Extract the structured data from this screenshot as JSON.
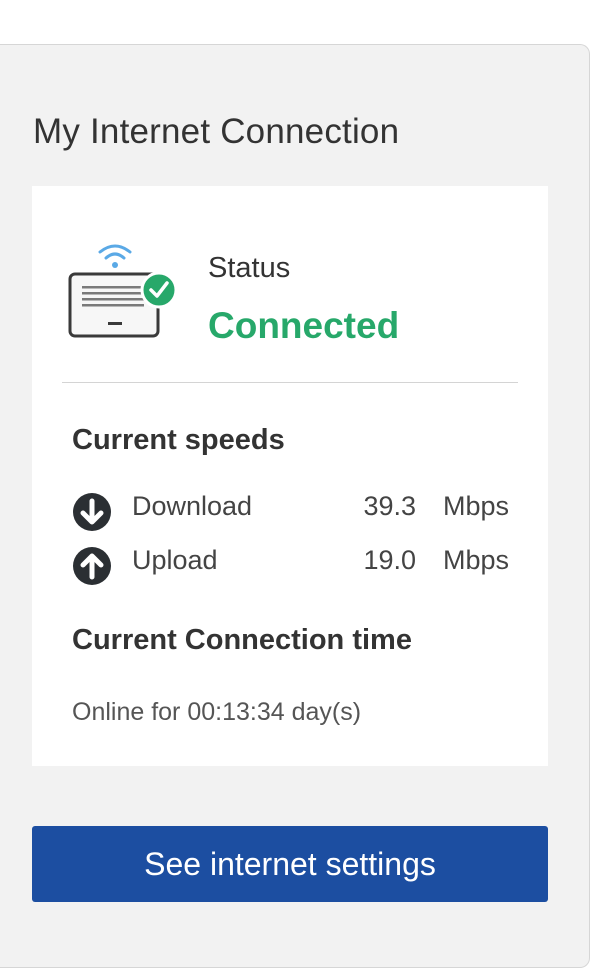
{
  "panel": {
    "title": "My Internet Connection"
  },
  "status": {
    "label": "Status",
    "value": "Connected",
    "icon": "router-connected-icon",
    "color": "#27a86a"
  },
  "speeds": {
    "title": "Current speeds",
    "download": {
      "label": "Download",
      "value": "39.3",
      "unit": "Mbps",
      "icon": "arrow-down-circle-icon"
    },
    "upload": {
      "label": "Upload",
      "value": "19.0",
      "unit": "Mbps",
      "icon": "arrow-up-circle-icon"
    }
  },
  "connection_time": {
    "title": "Current Connection time",
    "text": "Online for 00:13:34 day(s)"
  },
  "button": {
    "label": "See internet settings",
    "color": "#1c4ea1"
  }
}
